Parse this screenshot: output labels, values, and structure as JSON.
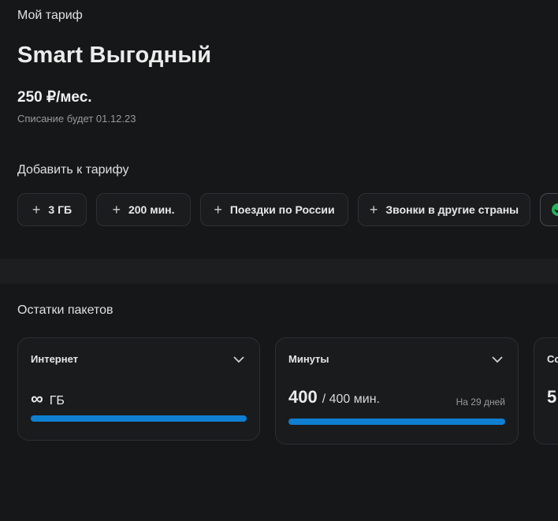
{
  "tariff": {
    "section_label": "Мой тариф",
    "name": "Smart Выгодный",
    "price": "250 ₽/мес.",
    "charge_note": "Списание будет 01.12.23"
  },
  "addons": {
    "title": "Добавить к тарифу",
    "chips": [
      {
        "label": "3 ГБ",
        "icon": "plus-icon"
      },
      {
        "label": "200 мин.",
        "icon": "plus-icon"
      },
      {
        "label": "Поездки по России",
        "icon": "plus-icon"
      },
      {
        "label": "Звонки в другие страны",
        "icon": "plus-icon"
      },
      {
        "label": "",
        "icon": "check-circle-icon"
      }
    ]
  },
  "packages": {
    "title": "Остатки пакетов",
    "cards": [
      {
        "title": "Интернет",
        "value_symbol": "∞",
        "unit": "ГБ",
        "progress": 1.0
      },
      {
        "title": "Минуты",
        "value": "400",
        "total": "/ 400 мин.",
        "period": "На 29 дней",
        "progress": 1.0
      },
      {
        "title": "Со",
        "value": "5"
      }
    ]
  },
  "colors": {
    "background": "#161718",
    "accent_bar": "#0f7fd1",
    "check_green": "#21b35a"
  }
}
